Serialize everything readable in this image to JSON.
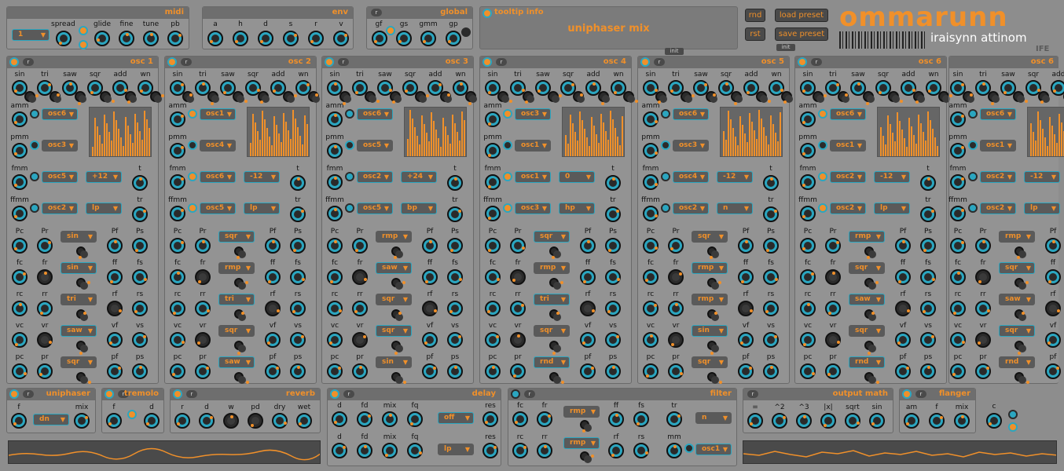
{
  "midi": {
    "title": "midi",
    "channel": "1",
    "labels": [
      "spread",
      "glide",
      "fine",
      "tune",
      "pb"
    ]
  },
  "env": {
    "title": "env",
    "labels": [
      "a",
      "h",
      "d",
      "s",
      "r",
      "v"
    ]
  },
  "global": {
    "title": "global",
    "labels": [
      "gf",
      "gs",
      "gmm",
      "gp"
    ]
  },
  "tooltip": {
    "title": "tooltip info",
    "text": "uniphaser mix",
    "tab": "init"
  },
  "buttons": {
    "rnd": "rnd",
    "rst": "rst",
    "load": "load preset",
    "save": "save preset",
    "init": "init"
  },
  "brand": {
    "logo": "ommarunn",
    "sub": "iraisynn attinom",
    "corner": "IFE"
  },
  "osc_labels": {
    "row1": [
      "sin",
      "tri",
      "saw",
      "sqr",
      "add",
      "wn"
    ],
    "amm": "amm",
    "pmm": "pmm",
    "fmm": "fmm",
    "ffmm": "ffmm",
    "t": "t",
    "tr": "tr",
    "mod_rows": [
      [
        "Pc",
        "Pr",
        "Pf",
        "Ps"
      ],
      [
        "fc",
        "fr",
        "ff",
        "fs"
      ],
      [
        "rc",
        "rr",
        "rf",
        "rs"
      ],
      [
        "vc",
        "vr",
        "vf",
        "vs"
      ],
      [
        "pc",
        "pr",
        "pf",
        "ps"
      ]
    ]
  },
  "oscs": [
    {
      "title": "osc 1",
      "amm": "osc6",
      "pmm": "osc3",
      "fmm": "osc5",
      "fmm_val": "+12",
      "ffmm": "osc2",
      "ffmm_mode": "lp",
      "shapes": [
        "sin",
        "sin",
        "tri",
        "saw",
        "sqr"
      ]
    },
    {
      "title": "osc 2",
      "amm": "osc1",
      "pmm": "osc4",
      "fmm": "osc6",
      "fmm_val": "-12",
      "ffmm": "osc5",
      "ffmm_mode": "lp",
      "shapes": [
        "sqr",
        "rmp",
        "tri",
        "sqr",
        "saw"
      ]
    },
    {
      "title": "osc 3",
      "amm": "osc6",
      "pmm": "osc5",
      "fmm": "osc2",
      "fmm_val": "+24",
      "ffmm": "osc5",
      "ffmm_mode": "bp",
      "shapes": [
        "rmp",
        "saw",
        "sqr",
        "sqr",
        "sin"
      ]
    },
    {
      "title": "osc 4",
      "amm": "osc3",
      "pmm": "osc1",
      "fmm": "osc1",
      "fmm_val": "0",
      "ffmm": "osc3",
      "ffmm_mode": "hp",
      "shapes": [
        "sqr",
        "rmp",
        "tri",
        "sqr",
        "rnd"
      ]
    },
    {
      "title": "osc 5",
      "amm": "osc6",
      "pmm": "osc3",
      "fmm": "osc4",
      "fmm_val": "-12",
      "ffmm": "osc2",
      "ffmm_mode": "n",
      "shapes": [
        "sqr",
        "rmp",
        "rmp",
        "sin",
        "sqr"
      ]
    },
    {
      "title": "osc 6",
      "amm": "osc6",
      "pmm": "osc1",
      "fmm": "osc2",
      "fmm_val": "-12",
      "ffmm": "osc2",
      "ffmm_mode": "lp",
      "shapes": [
        "rmp",
        "sqr",
        "saw",
        "sqr",
        "rnd"
      ]
    },
    {
      "title": "osc 6",
      "amm": "osc6",
      "pmm": "osc1",
      "fmm": "osc2",
      "fmm_val": "-12",
      "ffmm": "osc2",
      "ffmm_mode": "lp",
      "shapes": [
        "rmp",
        "sqr",
        "saw",
        "sqr",
        "rnd"
      ]
    }
  ],
  "uniphaser": {
    "title": "uniphaser",
    "labels": [
      "f",
      "mix"
    ],
    "mode": "dn"
  },
  "tremolo": {
    "title": "tremolo",
    "labels": [
      "f",
      "d"
    ]
  },
  "reverb": {
    "title": "reverb",
    "labels": [
      "r",
      "d",
      "w",
      "pd",
      "dry",
      "wet"
    ]
  },
  "delay": {
    "title": "delay",
    "labels": [
      "d",
      "fd",
      "mix",
      "fq",
      "res"
    ],
    "sel1": "off",
    "sel2": "lp"
  },
  "filter": {
    "title": "filter",
    "labels": [
      "fc",
      "fr",
      "ff",
      "fs",
      "rc",
      "rr",
      "rf",
      "rs",
      "tr",
      "mm"
    ],
    "sel1": "rmp",
    "sel2": "rmp",
    "mode": "n",
    "src": "osc1"
  },
  "output_math": {
    "title": "output math",
    "labels": [
      "=",
      "^2",
      "^3",
      "|x|",
      "sqrt",
      "sin"
    ]
  },
  "flanger": {
    "title": "flanger",
    "labels": [
      "am",
      "f",
      "mix",
      "c"
    ]
  },
  "colors": {
    "accent": "#f0902a",
    "teal": "#2ba6c0",
    "bg": "#8d8d8d"
  }
}
